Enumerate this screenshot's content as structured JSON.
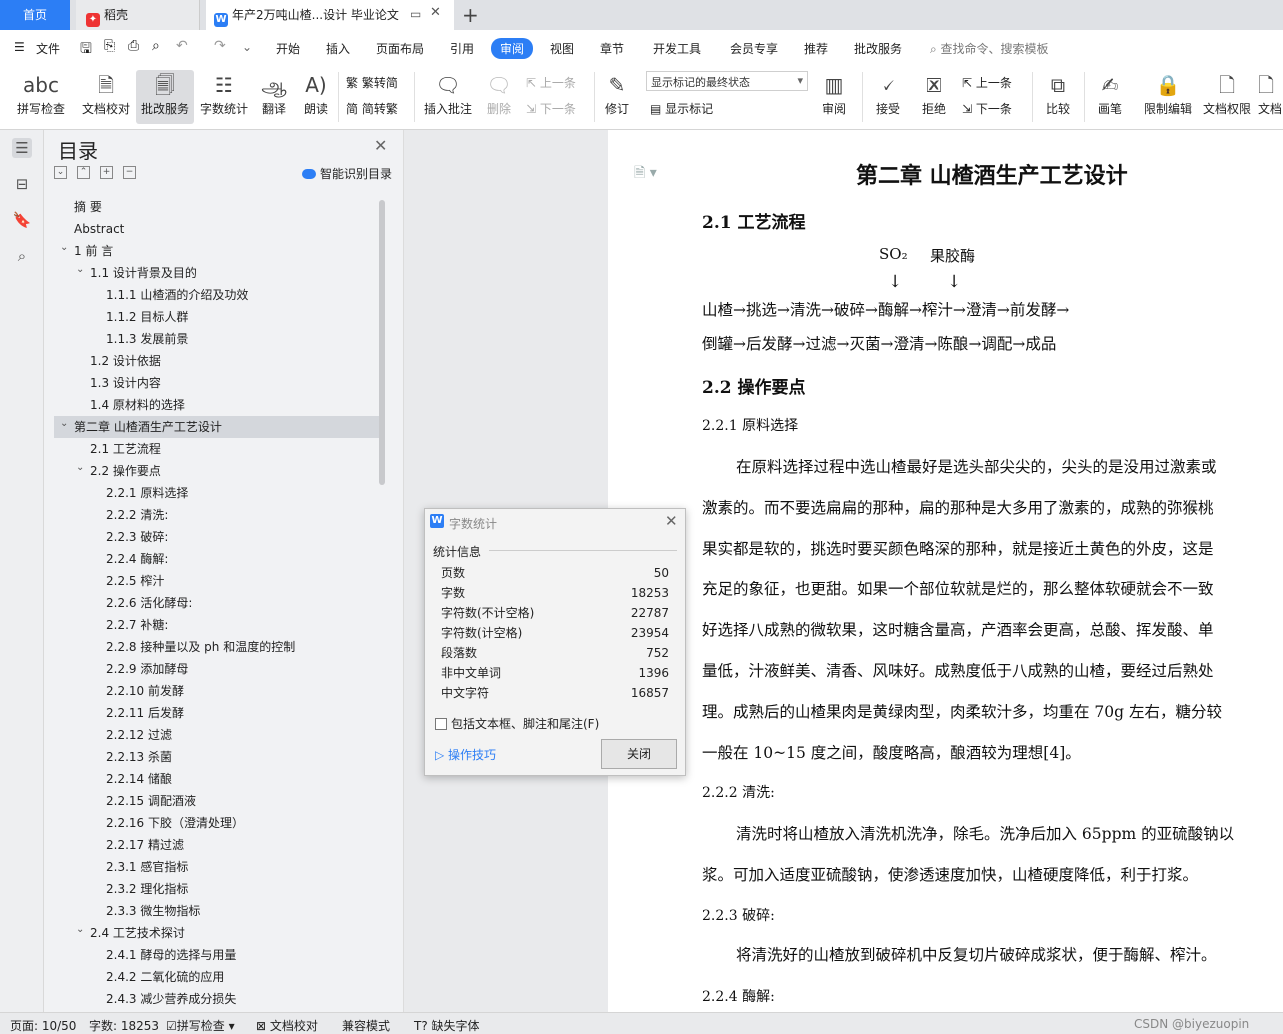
{
  "tabs": {
    "home": "首页",
    "daoke": "稻壳",
    "doc": "年产2万吨山楂...设计 毕业论文",
    "add": "+"
  },
  "menu": [
    "文件",
    "开始",
    "插入",
    "页面布局",
    "引用",
    "审阅",
    "视图",
    "章节",
    "开发工具",
    "会员专享",
    "推荐",
    "批改服务"
  ],
  "search_placeholder": "查找命令、搜索模板",
  "ribbon": {
    "spell": "拼写检查",
    "proof": "文档校对",
    "correct": "批改服务",
    "count": "字数统计",
    "translate": "翻译",
    "read": "朗读",
    "t2s": "繁转简",
    "s2t": "简转繁",
    "insert_comment": "插入批注",
    "delete": "删除",
    "prev": "上一条",
    "next": "下一条",
    "revise": "修订",
    "markup_state": "显示标记的最终状态",
    "show_markup": "显示标记",
    "review": "审阅",
    "accept": "接受",
    "reject": "拒绝",
    "prev2": "上一条",
    "next2": "下一条",
    "compare": "比较",
    "pen": "画笔",
    "restrict": "限制编辑",
    "perm": "文档权限",
    "doc": "文档"
  },
  "nav": {
    "title": "目录",
    "smart": "智能识别目录",
    "items": [
      {
        "t": "摘  要",
        "lv": 1
      },
      {
        "t": "Abstract",
        "lv": 1
      },
      {
        "t": "1 前  言",
        "lv": 1,
        "exp": true
      },
      {
        "t": "1.1 设计背景及目的",
        "lv": 2,
        "exp": true
      },
      {
        "t": "1.1.1 山楂酒的介绍及功效",
        "lv": 3
      },
      {
        "t": "1.1.2 目标人群",
        "lv": 3
      },
      {
        "t": "1.1.3 发展前景",
        "lv": 3
      },
      {
        "t": "1.2 设计依据",
        "lv": 2
      },
      {
        "t": "1.3 设计内容",
        "lv": 2
      },
      {
        "t": "1.4 原材料的选择",
        "lv": 2
      },
      {
        "t": "第二章 山楂酒生产工艺设计",
        "lv": 1,
        "exp": true,
        "sel": true
      },
      {
        "t": "2.1 工艺流程",
        "lv": 2
      },
      {
        "t": "2.2 操作要点",
        "lv": 2,
        "exp": true
      },
      {
        "t": "2.2.1 原料选择",
        "lv": 3
      },
      {
        "t": "2.2.2 清洗:",
        "lv": 3
      },
      {
        "t": "2.2.3 破碎:",
        "lv": 3
      },
      {
        "t": "2.2.4 酶解:",
        "lv": 3
      },
      {
        "t": "2.2.5 榨汁",
        "lv": 3
      },
      {
        "t": "2.2.6 活化酵母:",
        "lv": 3
      },
      {
        "t": "2.2.7 补糖:",
        "lv": 3
      },
      {
        "t": "2.2.8 接种量以及 ph 和温度的控制",
        "lv": 3
      },
      {
        "t": "2.2.9 添加酵母",
        "lv": 3
      },
      {
        "t": "2.2.10 前发酵",
        "lv": 3
      },
      {
        "t": "2.2.11 后发酵",
        "lv": 3
      },
      {
        "t": "2.2.12 过滤",
        "lv": 3
      },
      {
        "t": "2.2.13 杀菌",
        "lv": 3
      },
      {
        "t": "2.2.14 储酿",
        "lv": 3
      },
      {
        "t": "2.2.15 调配酒液",
        "lv": 3
      },
      {
        "t": "2.2.16 下胶（澄清处理）",
        "lv": 3
      },
      {
        "t": "2.2.17 精过滤",
        "lv": 3
      },
      {
        "t": "2.3.1 感官指标",
        "lv": 3
      },
      {
        "t": "2.3.2 理化指标",
        "lv": 3
      },
      {
        "t": "2.3.3 微生物指标",
        "lv": 3
      },
      {
        "t": "2.4 工艺技术探讨",
        "lv": 2,
        "exp": true
      },
      {
        "t": "2.4.1 酵母的选择与用量",
        "lv": 3
      },
      {
        "t": "2.4.2 二氧化硫的应用",
        "lv": 3
      },
      {
        "t": "2.4.3 减少营养成分损失",
        "lv": 3
      }
    ]
  },
  "doc": {
    "chapter": "第二章  山楂酒生产工艺设计",
    "s21": "2.1 工艺流程",
    "so2": "SO₂",
    "pectinase": "果胶酶",
    "down": "↓",
    "flow1": "山楂→挑选→清洗→破碎→酶解→榨汁→澄清→前发酵→",
    "flow2": "倒罐→后发酵→过滤→灭菌→澄清→陈酿→调配→成品",
    "s22": "2.2 操作要点",
    "s221": "2.2.1  原料选择",
    "p1": [
      "在原料选择过程中选山楂最好是选头部尖尖的，尖头的是没用过激素或",
      "激素的。而不要选扁扁的那种，扁的那种是大多用了激素的，成熟的弥猴桃",
      "果实都是软的，挑选时要买颜色略深的那种，就是接近土黄色的外皮，这是",
      "充足的象征，也更甜。如果一个部位软就是烂的，那么整体软硬就会不一致",
      "好选择八成熟的微软果，这时糖含量高，产酒率会更高，总酸、挥发酸、单",
      "量低，汁液鲜美、清香、风味好。成熟度低于八成熟的山楂，要经过后熟处",
      "理。成熟后的山楂果肉是黄绿肉型，肉柔软汁多，均重在 70g 左右，糖分较",
      "一般在 10~15 度之间，酸度略高，酿酒较为理想[4]。"
    ],
    "s222": "2.2.2  清洗:",
    "p2": [
      "清洗时将山楂放入清洗机洗净，除毛。洗净后加入 65ppm 的亚硫酸钠以",
      "浆。可加入适度亚硫酸钠，使渗透速度加快，山楂硬度降低，利于打浆。"
    ],
    "s223": "2.2.3  破碎:",
    "p3": "将清洗好的山楂放到破碎机中反复切片破碎成浆状，便于酶解、榨汁。",
    "s224": "2.2.4  酶解:"
  },
  "dialog": {
    "title": "字数统计",
    "section": "统计信息",
    "rows": [
      {
        "k": "页数",
        "v": "50"
      },
      {
        "k": "字数",
        "v": "18253"
      },
      {
        "k": "字符数(不计空格)",
        "v": "22787"
      },
      {
        "k": "字符数(计空格)",
        "v": "23954"
      },
      {
        "k": "段落数",
        "v": "752"
      },
      {
        "k": "非中文单词",
        "v": "1396"
      },
      {
        "k": "中文字符",
        "v": "16857"
      }
    ],
    "checkbox": "包括文本框、脚注和尾注(F)",
    "tips": "操作技巧",
    "close": "关闭"
  },
  "status": {
    "page": "页面: 10/50",
    "words": "字数: 18253",
    "spell": "拼写检查",
    "proof": "文档校对",
    "compat": "兼容模式",
    "font": "缺失字体",
    "csdn": "CSDN @biyezuopin"
  }
}
